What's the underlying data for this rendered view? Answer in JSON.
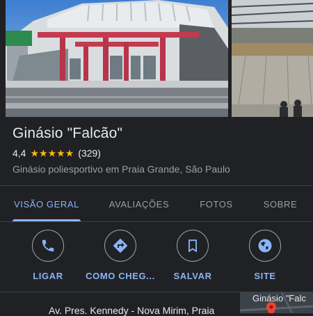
{
  "place": {
    "name": "Ginásio \"Falcão\"",
    "rating": "4,4",
    "stars": [
      "★",
      "★",
      "★",
      "★",
      "★"
    ],
    "review_count": "(329)",
    "category_location": "Ginásio poliesportivo em Praia Grande, São Paulo"
  },
  "tabs": [
    {
      "label": "VISÃO GERAL",
      "active": true
    },
    {
      "label": "AVALIAÇÕES",
      "active": false
    },
    {
      "label": "FOTOS",
      "active": false
    },
    {
      "label": "SOBRE",
      "active": false
    }
  ],
  "actions": [
    {
      "label": "LIGAR",
      "icon": "phone-icon"
    },
    {
      "label": "COMO CHEG...",
      "icon": "directions-icon"
    },
    {
      "label": "SALVAR",
      "icon": "bookmark-icon"
    },
    {
      "label": "SITE",
      "icon": "globe-icon"
    }
  ],
  "address": "Av. Pres. Kennedy - Nova Mirim, Praia",
  "map_label": "Ginásio \"Falc",
  "colors": {
    "background": "#202124",
    "accent": "#8ab4f8",
    "star": "#fbbc04",
    "secondary_text": "#9aa0a6",
    "map_pin": "#ea4335"
  }
}
